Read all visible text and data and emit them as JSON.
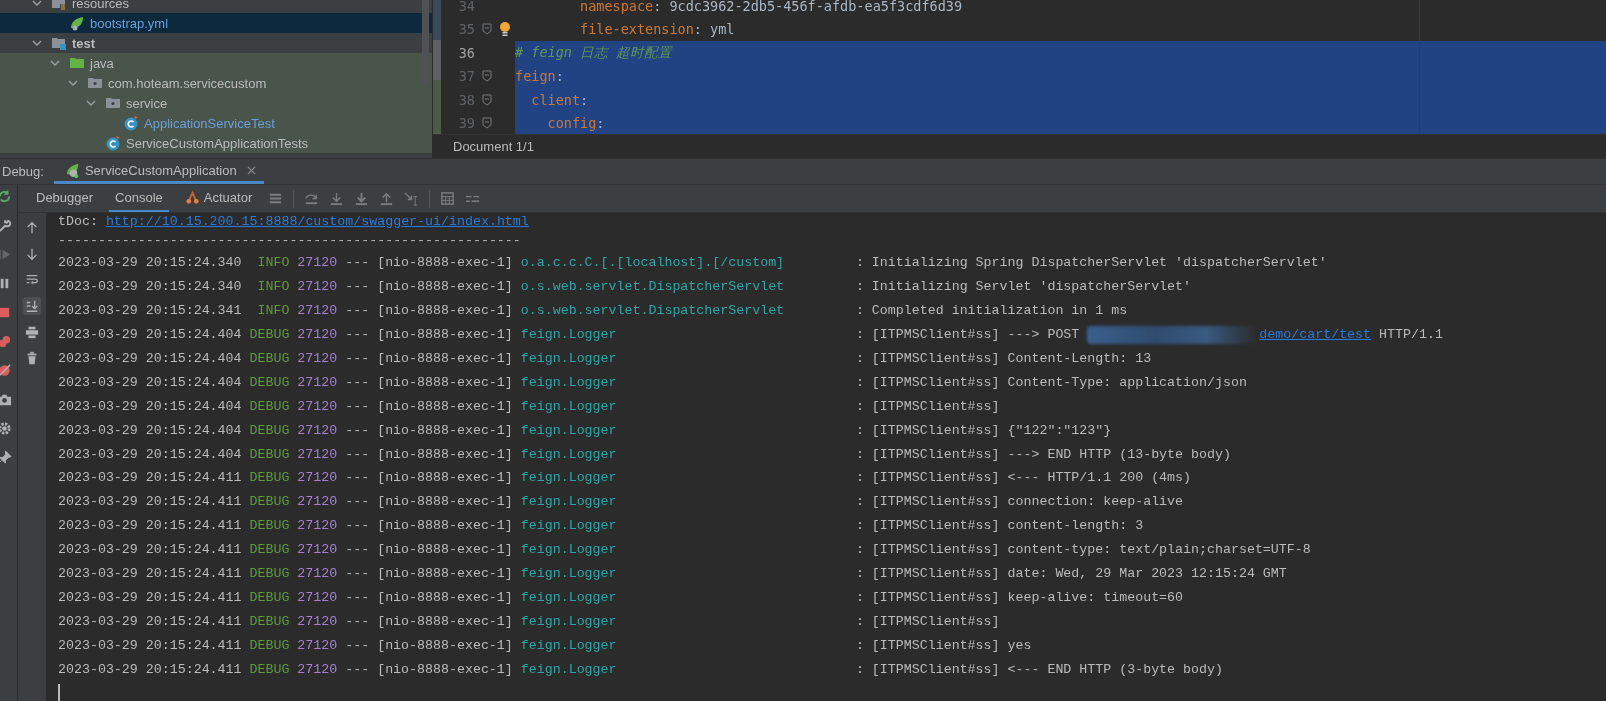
{
  "project_tree": {
    "items": [
      {
        "label": "resources",
        "kind": "resources-folder",
        "expanded": true,
        "selected": false,
        "added": false,
        "bold": false,
        "test_scope": false,
        "children": [
          {
            "label": "bootstrap.yml",
            "kind": "spring-file",
            "selected": true,
            "added": true,
            "bold": false,
            "test_scope": false
          }
        ]
      },
      {
        "label": "test",
        "kind": "test-root",
        "expanded": true,
        "selected": false,
        "added": false,
        "bold": true,
        "test_scope": false,
        "children": [
          {
            "label": "java",
            "kind": "source-folder",
            "expanded": true,
            "selected": false,
            "added": false,
            "bold": false,
            "test_scope": true,
            "children": [
              {
                "label": "com.hoteam.servicecustom",
                "kind": "package",
                "expanded": true,
                "selected": false,
                "added": false,
                "bold": false,
                "test_scope": true,
                "children": [
                  {
                    "label": "service",
                    "kind": "package",
                    "expanded": true,
                    "selected": false,
                    "added": false,
                    "bold": false,
                    "test_scope": true,
                    "children": [
                      {
                        "label": "ApplicationServiceTest",
                        "kind": "test-class",
                        "selected": false,
                        "added": true,
                        "bold": false,
                        "test_scope": true
                      }
                    ]
                  },
                  {
                    "label": "ServiceCustomApplicationTests",
                    "kind": "test-class",
                    "selected": false,
                    "added": false,
                    "bold": false,
                    "test_scope": true
                  }
                ]
              }
            ]
          }
        ]
      }
    ]
  },
  "editor": {
    "lines": [
      {
        "number": "34",
        "selected": false,
        "current": false,
        "foldable": false,
        "bulb": false,
        "tokens": [
          {
            "kind": "key",
            "text": "        namespace"
          },
          {
            "kind": "punct",
            "text": ": "
          },
          {
            "kind": "value",
            "text": "9cdc3962-2db5-456f-afdb-ea5f3cdf6d39"
          }
        ]
      },
      {
        "number": "35",
        "selected": false,
        "current": false,
        "foldable": true,
        "bulb": true,
        "tokens": [
          {
            "kind": "key",
            "text": "        file-extension"
          },
          {
            "kind": "punct",
            "text": ": "
          },
          {
            "kind": "value",
            "text": "yml"
          }
        ]
      },
      {
        "number": "36",
        "selected": true,
        "current": true,
        "foldable": false,
        "bulb": false,
        "tokens": [
          {
            "kind": "comment",
            "text": "# feign 日志 超时配置"
          }
        ]
      },
      {
        "number": "37",
        "selected": true,
        "current": false,
        "foldable": true,
        "bulb": false,
        "tokens": [
          {
            "kind": "key",
            "text": "feign"
          },
          {
            "kind": "punct",
            "text": ":"
          }
        ]
      },
      {
        "number": "38",
        "selected": true,
        "current": false,
        "foldable": true,
        "bulb": false,
        "tokens": [
          {
            "kind": "key",
            "text": "  client"
          },
          {
            "kind": "punct",
            "text": ":"
          }
        ]
      },
      {
        "number": "39",
        "selected": true,
        "current": false,
        "foldable": true,
        "bulb": false,
        "tokens": [
          {
            "kind": "key",
            "text": "    config"
          },
          {
            "kind": "punct",
            "text": ":"
          }
        ]
      }
    ],
    "breadcrumb": "Document 1/1"
  },
  "debug": {
    "label": "Debug:",
    "tabs": [
      {
        "label": "ServiceCustomApplication",
        "selected": true
      }
    ],
    "side_tools": [
      {
        "kind": "rerun",
        "disabled": false
      },
      {
        "kind": "wrench",
        "disabled": false
      },
      {
        "kind": "resume",
        "disabled": true
      },
      {
        "kind": "pause",
        "disabled": false
      },
      {
        "kind": "stop",
        "disabled": false
      },
      {
        "kind": "breakpoints",
        "disabled": false
      },
      {
        "kind": "mute",
        "disabled": false
      },
      {
        "kind": "camera",
        "disabled": false
      },
      {
        "kind": "gear",
        "disabled": false
      },
      {
        "kind": "pin",
        "disabled": false
      }
    ],
    "view_tabs": [
      {
        "label": "Debugger",
        "selected": false,
        "kind": "plain"
      },
      {
        "label": "Console",
        "selected": true,
        "kind": "plain"
      },
      {
        "label": "Actuator",
        "selected": false,
        "kind": "actuator"
      }
    ],
    "toolbar": [
      {
        "kind": "menu"
      },
      {
        "kind": "step-over"
      },
      {
        "kind": "step-into"
      },
      {
        "kind": "force-step-into"
      },
      {
        "kind": "step-out"
      },
      {
        "kind": "run-to-cursor"
      },
      {
        "kind": "calculator"
      },
      {
        "kind": "trace"
      }
    ],
    "console_tools": [
      {
        "kind": "up",
        "on": false
      },
      {
        "kind": "down",
        "on": false
      },
      {
        "kind": "wrap",
        "on": false
      },
      {
        "kind": "scroll-end",
        "on": true
      },
      {
        "kind": "print",
        "on": false
      },
      {
        "kind": "trash",
        "on": false
      }
    ],
    "console": {
      "preamble": [
        {
          "prefix": "tDoc: ",
          "link": "http://10.15.200.15:8888/custom/swagger-ui/index.html"
        },
        {
          "prefix": "----------------------------------------------------------"
        }
      ],
      "lines": [
        {
          "timestamp": "2023-03-29 20:15:24.340",
          "level": "INFO",
          "pid": "27120",
          "separator": "---",
          "thread": "[nio-8888-exec-1]",
          "logger": "o.a.c.c.C.[.[localhost].[/custom]",
          "message": ": Initializing Spring DispatcherServlet 'dispatcherServlet'"
        },
        {
          "timestamp": "2023-03-29 20:15:24.340",
          "level": "INFO",
          "pid": "27120",
          "separator": "---",
          "thread": "[nio-8888-exec-1]",
          "logger": "o.s.web.servlet.DispatcherServlet",
          "message": ": Initializing Servlet 'dispatcherServlet'"
        },
        {
          "timestamp": "2023-03-29 20:15:24.341",
          "level": "INFO",
          "pid": "27120",
          "separator": "---",
          "thread": "[nio-8888-exec-1]",
          "logger": "o.s.web.servlet.DispatcherServlet",
          "message": ": Completed initialization in 1 ms"
        },
        {
          "timestamp": "2023-03-29 20:15:24.404",
          "level": "DEBUG",
          "pid": "27120",
          "separator": "---",
          "thread": "[nio-8888-exec-1]",
          "logger": "feign.Logger",
          "message": ": [ITPMSClient#ss] ---> POST",
          "redacted": true,
          "link": "demo/cart/test",
          "tail": "HTTP/1.1"
        },
        {
          "timestamp": "2023-03-29 20:15:24.404",
          "level": "DEBUG",
          "pid": "27120",
          "separator": "---",
          "thread": "[nio-8888-exec-1]",
          "logger": "feign.Logger",
          "message": ": [ITPMSClient#ss] Content-Length: 13"
        },
        {
          "timestamp": "2023-03-29 20:15:24.404",
          "level": "DEBUG",
          "pid": "27120",
          "separator": "---",
          "thread": "[nio-8888-exec-1]",
          "logger": "feign.Logger",
          "message": ": [ITPMSClient#ss] Content-Type: application/json"
        },
        {
          "timestamp": "2023-03-29 20:15:24.404",
          "level": "DEBUG",
          "pid": "27120",
          "separator": "---",
          "thread": "[nio-8888-exec-1]",
          "logger": "feign.Logger",
          "message": ": [ITPMSClient#ss]"
        },
        {
          "timestamp": "2023-03-29 20:15:24.404",
          "level": "DEBUG",
          "pid": "27120",
          "separator": "---",
          "thread": "[nio-8888-exec-1]",
          "logger": "feign.Logger",
          "message": ": [ITPMSClient#ss] {\"122\":\"123\"}"
        },
        {
          "timestamp": "2023-03-29 20:15:24.404",
          "level": "DEBUG",
          "pid": "27120",
          "separator": "---",
          "thread": "[nio-8888-exec-1]",
          "logger": "feign.Logger",
          "message": ": [ITPMSClient#ss] ---> END HTTP (13-byte body)"
        },
        {
          "timestamp": "2023-03-29 20:15:24.411",
          "level": "DEBUG",
          "pid": "27120",
          "separator": "---",
          "thread": "[nio-8888-exec-1]",
          "logger": "feign.Logger",
          "message": ": [ITPMSClient#ss] <--- HTTP/1.1 200 (4ms)"
        },
        {
          "timestamp": "2023-03-29 20:15:24.411",
          "level": "DEBUG",
          "pid": "27120",
          "separator": "---",
          "thread": "[nio-8888-exec-1]",
          "logger": "feign.Logger",
          "message": ": [ITPMSClient#ss] connection: keep-alive"
        },
        {
          "timestamp": "2023-03-29 20:15:24.411",
          "level": "DEBUG",
          "pid": "27120",
          "separator": "---",
          "thread": "[nio-8888-exec-1]",
          "logger": "feign.Logger",
          "message": ": [ITPMSClient#ss] content-length: 3"
        },
        {
          "timestamp": "2023-03-29 20:15:24.411",
          "level": "DEBUG",
          "pid": "27120",
          "separator": "---",
          "thread": "[nio-8888-exec-1]",
          "logger": "feign.Logger",
          "message": ": [ITPMSClient#ss] content-type: text/plain;charset=UTF-8"
        },
        {
          "timestamp": "2023-03-29 20:15:24.411",
          "level": "DEBUG",
          "pid": "27120",
          "separator": "---",
          "thread": "[nio-8888-exec-1]",
          "logger": "feign.Logger",
          "message": ": [ITPMSClient#ss] date: Wed, 29 Mar 2023 12:15:24 GMT"
        },
        {
          "timestamp": "2023-03-29 20:15:24.411",
          "level": "DEBUG",
          "pid": "27120",
          "separator": "---",
          "thread": "[nio-8888-exec-1]",
          "logger": "feign.Logger",
          "message": ": [ITPMSClient#ss] keep-alive: timeout=60"
        },
        {
          "timestamp": "2023-03-29 20:15:24.411",
          "level": "DEBUG",
          "pid": "27120",
          "separator": "---",
          "thread": "[nio-8888-exec-1]",
          "logger": "feign.Logger",
          "message": ": [ITPMSClient#ss]"
        },
        {
          "timestamp": "2023-03-29 20:15:24.411",
          "level": "DEBUG",
          "pid": "27120",
          "separator": "---",
          "thread": "[nio-8888-exec-1]",
          "logger": "feign.Logger",
          "message": ": [ITPMSClient#ss] yes"
        },
        {
          "timestamp": "2023-03-29 20:15:24.411",
          "level": "DEBUG",
          "pid": "27120",
          "separator": "---",
          "thread": "[nio-8888-exec-1]",
          "logger": "feign.Logger",
          "message": ": [ITPMSClient#ss] <--- END HTTP (3-byte body)"
        }
      ]
    }
  }
}
